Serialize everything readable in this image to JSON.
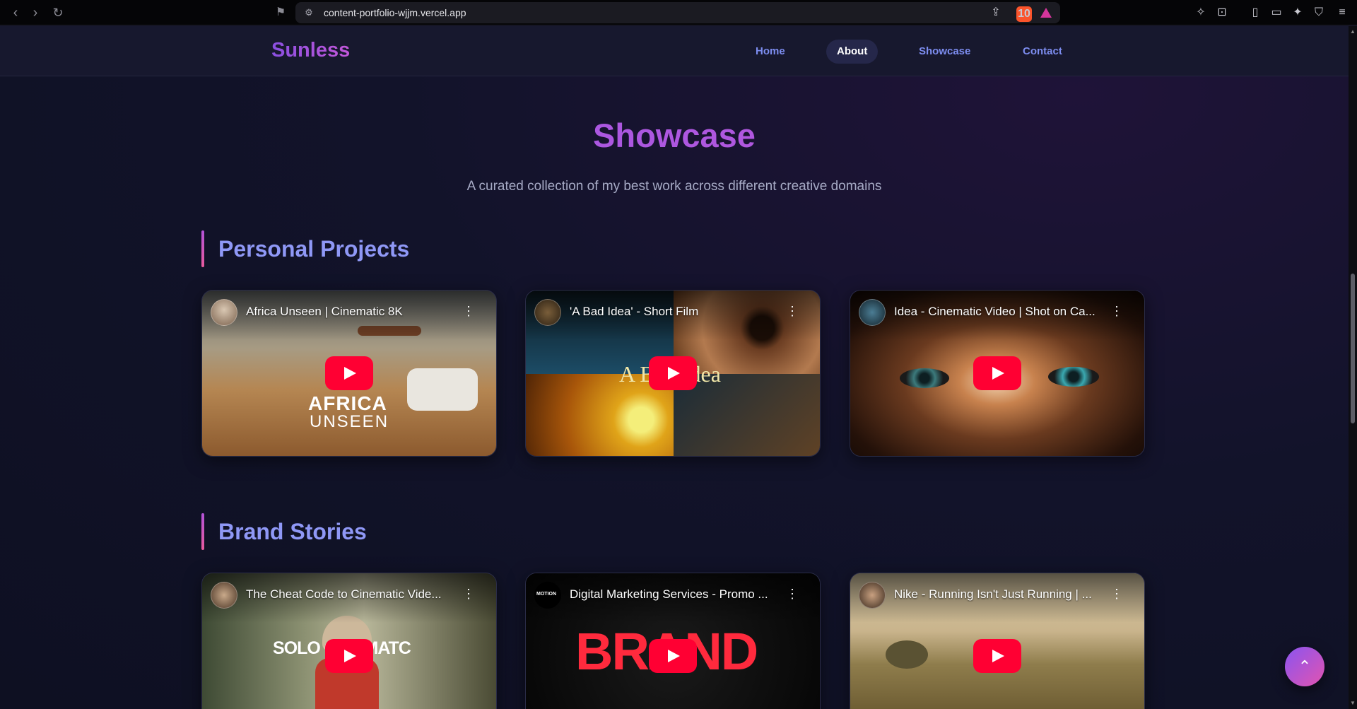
{
  "browser": {
    "url": "content-portfolio-wjjm.vercel.app",
    "brave_badge": "10"
  },
  "site": {
    "logo": "Sunless",
    "nav": [
      {
        "label": "Home",
        "active": false
      },
      {
        "label": "About",
        "active": true
      },
      {
        "label": "Showcase",
        "active": false
      },
      {
        "label": "Contact",
        "active": false
      }
    ]
  },
  "showcase": {
    "title": "Showcase",
    "subtitle": "A curated collection of my best work across different creative domains"
  },
  "sections": [
    {
      "title": "Personal Projects",
      "videos": [
        {
          "title": "Africa Unseen | Cinematic 8K",
          "overlay": [
            "AFRICA",
            "UNSEEN"
          ]
        },
        {
          "title": "'A Bad Idea' - Short Film",
          "overlay": [
            "A Bad Idea"
          ]
        },
        {
          "title": "Idea - Cinematic Video | Shot on Ca...",
          "overlay": []
        }
      ]
    },
    {
      "title": "Brand Stories",
      "videos": [
        {
          "title": "The Cheat Code to Cinematic Vide...",
          "overlay": [
            "SOLO CINEMATC"
          ]
        },
        {
          "title": "Digital Marketing Services - Promo ...",
          "overlay": [
            "BRAND"
          ],
          "channel_tag": "MOTION"
        },
        {
          "title": "Nike - Running Isn't Just Running | ...",
          "overlay": []
        }
      ]
    }
  ],
  "colors": {
    "accent_purple": "#9b5de5",
    "nav_link": "#7d8df0",
    "play_red": "#ff0033",
    "page_bg": "#0f1024"
  },
  "icons": {
    "back": "chevron-left-icon",
    "forward": "chevron-right-icon",
    "reload": "reload-icon",
    "bookmark": "bookmark-icon",
    "scroll_top": "arrow-up-icon"
  }
}
